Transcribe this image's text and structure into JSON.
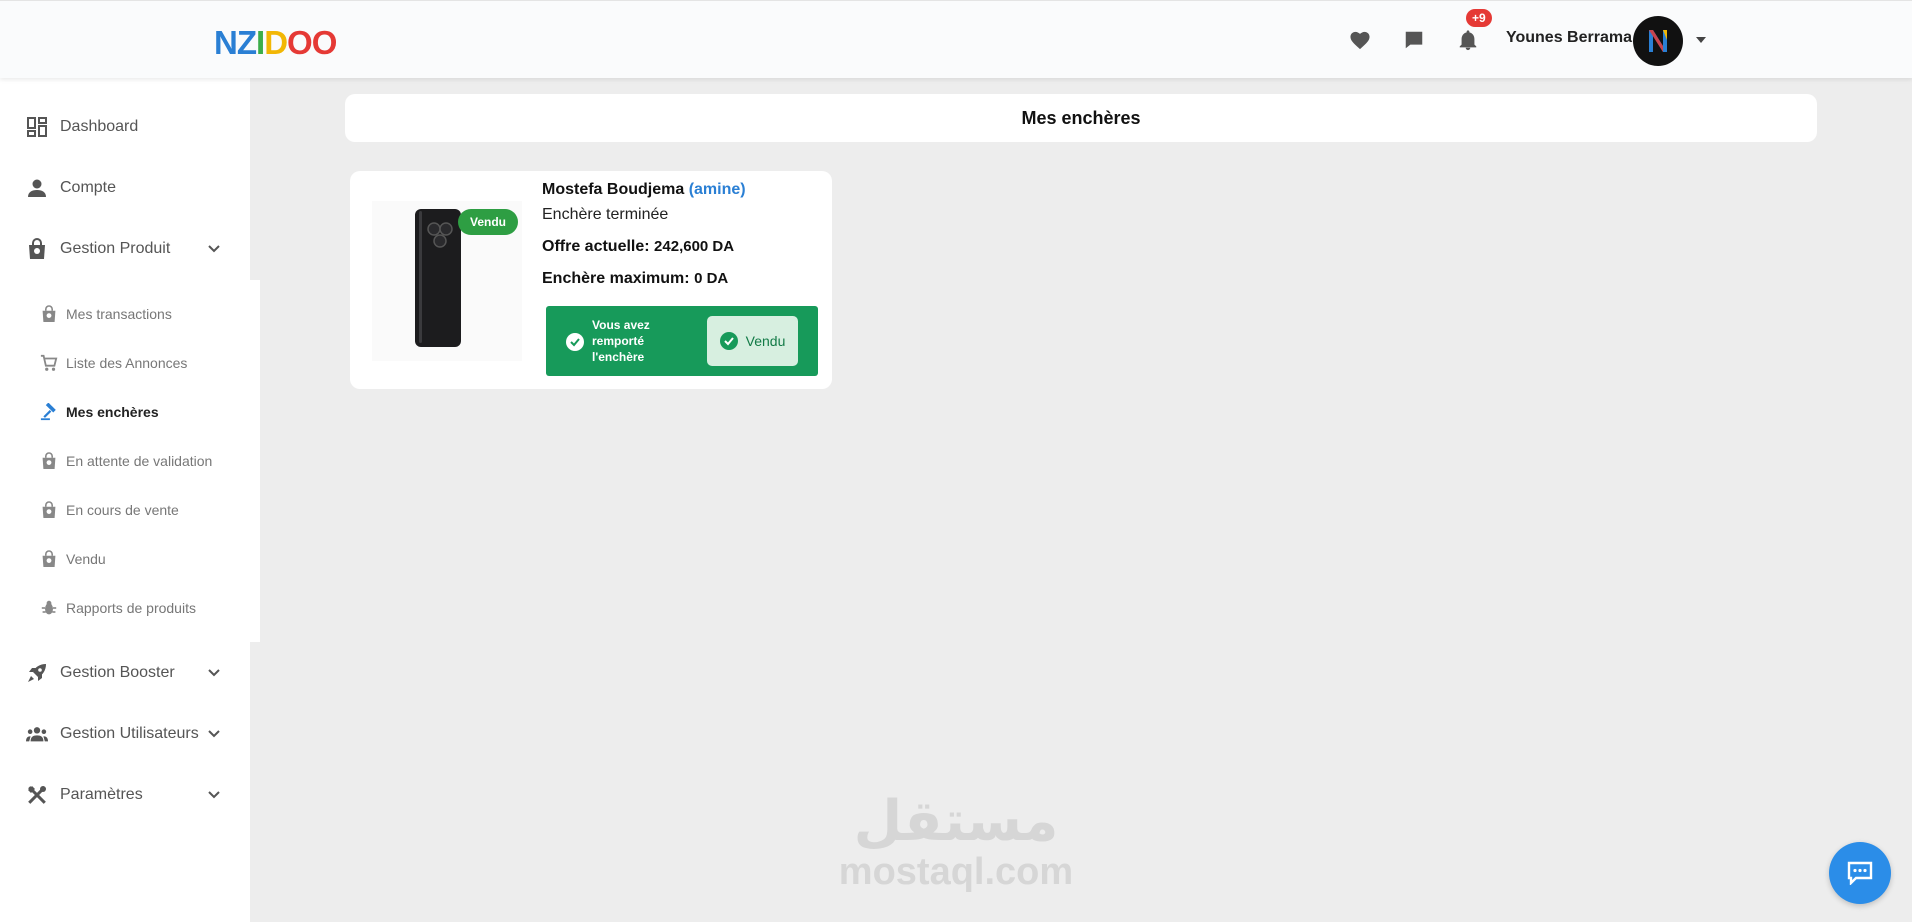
{
  "header": {
    "logo_letters": [
      {
        "ch": "N",
        "color": "#2a7fd4"
      },
      {
        "ch": "Z",
        "color": "#2a7fd4"
      },
      {
        "ch": "I",
        "color": "#3cae4a"
      },
      {
        "ch": "D",
        "color": "#f2b705"
      },
      {
        "ch": "O",
        "color": "#e53935"
      },
      {
        "ch": "O",
        "color": "#e53935"
      }
    ],
    "icons": [
      "heart-icon",
      "chat-bubble-icon",
      "bell-icon"
    ],
    "notification_count": "+9",
    "username": "Younes Berrama"
  },
  "sidebar": {
    "items": [
      {
        "label": "Dashboard",
        "icon": "dashboard-icon"
      },
      {
        "label": "Compte",
        "icon": "person-icon"
      },
      {
        "label": "Gestion Produit",
        "icon": "bag-icon",
        "expanded": true
      }
    ],
    "sub_items": [
      {
        "label": "Mes transactions",
        "icon": "bag-icon"
      },
      {
        "label": "Liste des Annonces",
        "icon": "cart-icon"
      },
      {
        "label": "Mes enchères",
        "icon": "gavel-icon",
        "active": true
      },
      {
        "label": "En attente de validation",
        "icon": "bag-icon"
      },
      {
        "label": "En cours de vente",
        "icon": "bag-icon"
      },
      {
        "label": "Vendu",
        "icon": "bag-icon"
      },
      {
        "label": "Rapports de produits",
        "icon": "bug-icon"
      }
    ],
    "bottom_items": [
      {
        "label": "Gestion Booster",
        "icon": "rocket-icon"
      },
      {
        "label": "Gestion Utilisateurs",
        "icon": "group-icon"
      },
      {
        "label": "Paramètres",
        "icon": "tools-icon"
      }
    ]
  },
  "main": {
    "page_title": "Mes enchères",
    "auction": {
      "sold_tag": "Vendu",
      "seller_name": "Mostefa Boudjema",
      "seller_alias": "(amine)",
      "status": "Enchère terminée",
      "offer_label": "Offre actuelle:",
      "offer_value": "242,600 DA",
      "max_label": "Enchère maximum:",
      "max_value": "0 DA",
      "win_message": "Vous avez remporté l'enchère",
      "win_button": "Vendu"
    }
  },
  "watermark": {
    "arabic": "مستقل",
    "latin": "mostaql.com"
  },
  "colors": {
    "accent": "#2a7fd4",
    "success": "#179a5a",
    "sold_tag": "#2e9e43",
    "badge": "#e53935"
  }
}
